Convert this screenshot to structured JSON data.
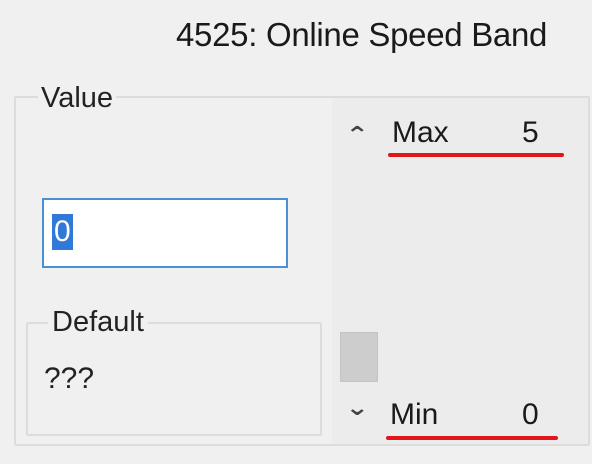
{
  "dialog": {
    "title": "4525: Online Speed Band"
  },
  "value_group": {
    "legend": "Value",
    "input_value": "0"
  },
  "default_group": {
    "legend": "Default",
    "value": "???"
  },
  "range": {
    "max_label": "Max",
    "max_value": "5",
    "min_label": "Min",
    "min_value": "0",
    "underline_color": "#e0161b"
  },
  "slider": {
    "up_icon": "chevron-up-icon",
    "down_icon": "chevron-down-icon",
    "position": 0
  }
}
